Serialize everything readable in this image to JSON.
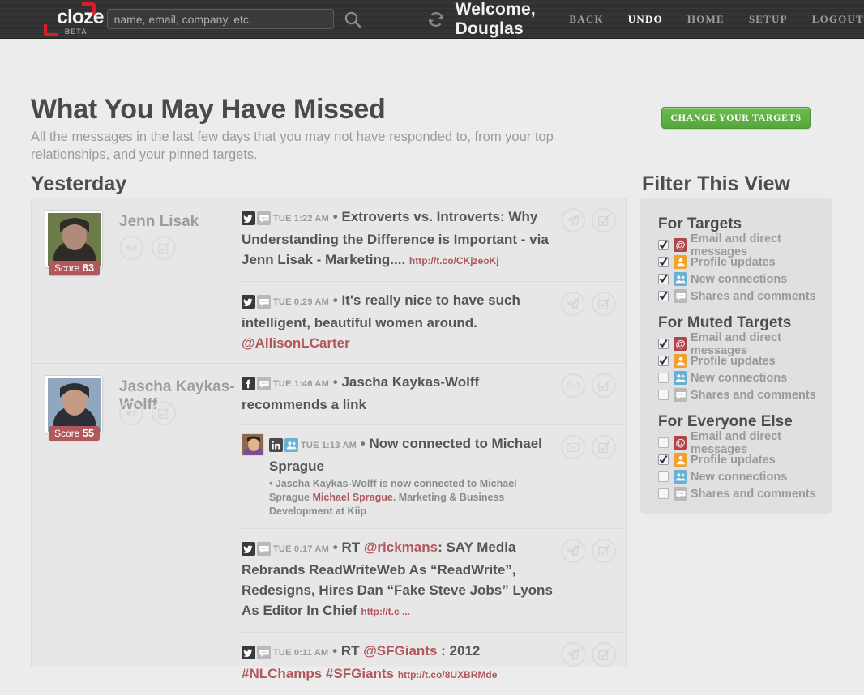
{
  "header": {
    "logo_text": "cloze",
    "logo_beta": "BETA",
    "search_placeholder": "name, email, company, etc.",
    "search_value": "",
    "welcome": "Welcome, Douglas",
    "nav": [
      {
        "label": "BACK",
        "active": false
      },
      {
        "label": "UNDO",
        "active": true
      },
      {
        "label": "HOME",
        "active": false
      },
      {
        "label": "SETUP",
        "active": false
      },
      {
        "label": "LOGOUT",
        "active": false
      }
    ]
  },
  "page": {
    "title": "What You May Have Missed",
    "subtitle": "All the messages in the last few days that you may not have responded to, from your top relationships, and your pinned targets.",
    "day_label": "Yesterday",
    "cta_label": "CHANGE YOUR TARGETS"
  },
  "feed": [
    {
      "name": "Jenn Lisak",
      "score_word": "Score",
      "score_value": "83",
      "avatar_colors": [
        "#6d7a4a",
        "#2e2b28",
        "#b08a7a"
      ],
      "messages": [
        {
          "sources": [
            "twitter-icon",
            "comment-icon"
          ],
          "time": "TUE 1:22 AM",
          "text": "Extroverts vs. Introverts: Why Understanding the Difference is Important - via Jenn Lisak - Marketing....",
          "link": "http://t.co/CKjzeoKj",
          "actions": [
            "send-icon",
            "mark-done-icon"
          ]
        },
        {
          "sources": [
            "twitter-icon",
            "comment-icon"
          ],
          "time": "TUE 0:29 AM",
          "text": "It's really nice to have such intelligent, beautiful women around.",
          "mention": "@AllisonLCarter",
          "actions": [
            "send-icon",
            "mark-done-icon"
          ]
        }
      ]
    },
    {
      "name": "Jascha Kaykas-Wolff",
      "score_word": "Score",
      "score_value": "55",
      "avatar_colors": [
        "#8fa8bd",
        "#2b2f38",
        "#c79a84"
      ],
      "messages": [
        {
          "sources": [
            "facebook-icon",
            "comment-icon"
          ],
          "time": "TUE 1:46 AM",
          "text": "Jascha Kaykas-Wolff recommends a link",
          "actions": [
            "email-icon",
            "mark-done-icon"
          ]
        },
        {
          "sources": [
            "linkedin-icon",
            "connection-icon"
          ],
          "time": "TUE 1:13 AM",
          "text": "Now connected to Michael Sprague",
          "subtext_prefix": "• Jascha Kaykas-Wolff is now connected to Michael Sprague ",
          "subtext_link": "Michael Sprague",
          "subtext_suffix": ". Marketing & Business Development at Kiip",
          "has_thumb": true,
          "actions": [
            "email-icon",
            "mark-done-icon"
          ]
        },
        {
          "sources": [
            "twitter-icon",
            "comment-icon"
          ],
          "time": "TUE 0:17 AM",
          "text_prefix": "RT ",
          "mention_lead": "@rickmans",
          "text": ": SAY Media Rebrands ReadWriteWeb As “ReadWrite”, Redesigns, Hires Dan “Fake Steve Jobs” Lyons As Editor In Chief",
          "link": "http://t.c ...",
          "actions": [
            "send-icon",
            "mark-done-icon"
          ]
        },
        {
          "sources": [
            "twitter-icon",
            "comment-icon"
          ],
          "time": "TUE 0:11 AM",
          "text_prefix": "RT ",
          "mention_lead": "@SFGiants",
          "text": " : 2012 ",
          "hashtag1": "#NLChamps",
          "hashtag2": "#SFGiants",
          "link": "http://t.co/8UXBRMde",
          "actions": [
            "send-icon",
            "mark-done-icon"
          ]
        }
      ]
    }
  ],
  "filter": {
    "title": "Filter This View",
    "groups": [
      {
        "heading": "For Targets",
        "rows": [
          {
            "label": "Email and direct messages",
            "icon": "at-icon",
            "checked": true
          },
          {
            "label": "Profile updates",
            "icon": "profile-icon",
            "checked": true
          },
          {
            "label": "New connections",
            "icon": "connection-icon",
            "checked": true
          },
          {
            "label": "Shares and comments",
            "icon": "comment-icon",
            "checked": true
          }
        ]
      },
      {
        "heading": "For Muted Targets",
        "rows": [
          {
            "label": "Email and direct messages",
            "icon": "at-icon",
            "checked": true
          },
          {
            "label": "Profile updates",
            "icon": "profile-icon",
            "checked": true
          },
          {
            "label": "New connections",
            "icon": "connection-icon",
            "checked": false
          },
          {
            "label": "Shares and comments",
            "icon": "comment-icon",
            "checked": false
          }
        ]
      },
      {
        "heading": "For Everyone Else",
        "rows": [
          {
            "label": "Email and direct messages",
            "icon": "at-icon",
            "checked": false
          },
          {
            "label": "Profile updates",
            "icon": "profile-icon",
            "checked": true
          },
          {
            "label": "New connections",
            "icon": "connection-icon",
            "checked": false
          },
          {
            "label": "Shares and comments",
            "icon": "comment-icon",
            "checked": false
          }
        ]
      }
    ]
  },
  "colors": {
    "accent_red": "#b0585c",
    "cta_green": "#54a83b",
    "page_bg": "#ececec",
    "topbar": "#333333"
  }
}
